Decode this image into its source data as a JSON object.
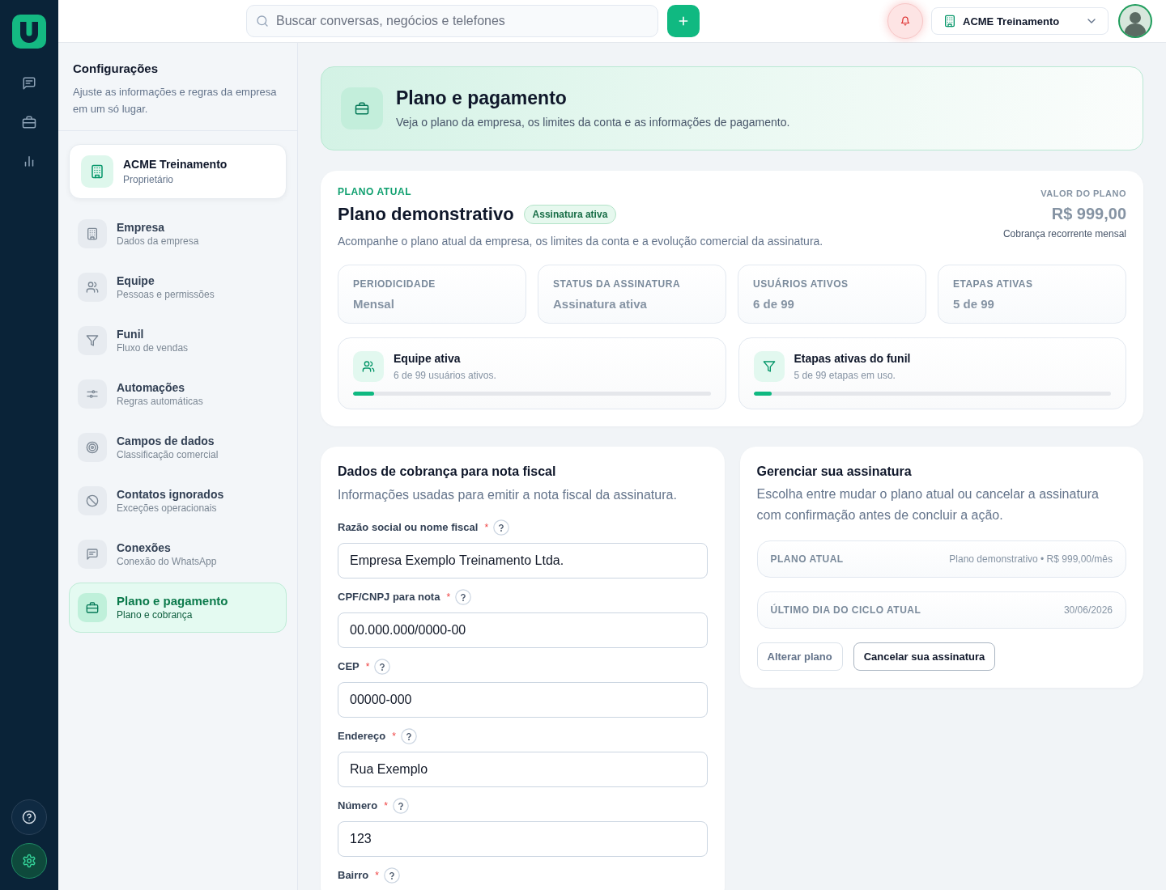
{
  "rail": {
    "top_items": [
      {
        "kind": "chat",
        "selected": false
      },
      {
        "kind": "briefcase",
        "selected": false
      },
      {
        "kind": "chart",
        "selected": false
      }
    ],
    "bottom_items": [
      {
        "kind": "help",
        "selected": false
      },
      {
        "kind": "settings",
        "selected": true
      }
    ]
  },
  "topbar": {
    "search": {
      "placeholder": "Buscar conversas, negócios e telefones"
    },
    "notifications": {
      "alert": true
    },
    "company": {
      "name": "ACME Treinamento"
    }
  },
  "settings_nav": {
    "title": "Configurações",
    "description": "Ajuste as informações e regras da empresa em um só lugar.",
    "account": {
      "name": "ACME Treinamento",
      "role": "Proprietário"
    },
    "items": [
      {
        "kind": "building",
        "title": "Empresa",
        "subtitle": "Dados da empresa",
        "selected": false
      },
      {
        "kind": "users",
        "title": "Equipe",
        "subtitle": "Pessoas e permissões",
        "selected": false
      },
      {
        "kind": "funnel",
        "title": "Funil",
        "subtitle": "Fluxo de vendas",
        "selected": false
      },
      {
        "kind": "sliders",
        "title": "Automações",
        "subtitle": "Regras automáticas",
        "selected": false
      },
      {
        "kind": "target",
        "title": "Campos de dados",
        "subtitle": "Classificação comercial",
        "selected": false
      },
      {
        "kind": "ban",
        "title": "Contatos ignorados",
        "subtitle": "Exceções operacionais",
        "selected": false
      },
      {
        "kind": "chat",
        "title": "Conexões",
        "subtitle": "Conexão do WhatsApp",
        "selected": false
      },
      {
        "kind": "briefcase",
        "title": "Plano e pagamento",
        "subtitle": "Plano e cobrança",
        "selected": true
      }
    ]
  },
  "header": {
    "title": "Plano e pagamento",
    "description": "Veja o plano da empresa, os limites da conta e as informações de pagamento."
  },
  "plan": {
    "eyebrow": "PLANO ATUAL",
    "name": "Plano demonstrativo",
    "badge": "Assinatura ativa",
    "description": "Acompanhe o plano atual da empresa, os limites da conta e a evolução comercial da assinatura.",
    "price_label": "VALOR DO PLANO",
    "price": "R$ 999,00",
    "price_note": "Cobrança recorrente mensal",
    "stats": [
      {
        "label": "PERIODICIDADE",
        "value": "Mensal"
      },
      {
        "label": "STATUS DA ASSINATURA",
        "value": "Assinatura ativa"
      },
      {
        "label": "USUÁRIOS ATIVOS",
        "value": "6 de 99"
      },
      {
        "label": "ETAPAS ATIVAS",
        "value": "5 de 99"
      }
    ],
    "usage": [
      {
        "kind": "users",
        "title": "Equipe ativa",
        "detail": "6 de 99 usuários ativos.",
        "level": 0.06
      },
      {
        "kind": "funnel",
        "title": "Etapas ativas do funil",
        "detail": "5 de 99 etapas em uso.",
        "level": 0.05
      }
    ]
  },
  "billing": {
    "title": "Dados de cobrança para nota fiscal",
    "description": "Informações usadas para emitir a nota fiscal da assinatura.",
    "fields": [
      {
        "label": "Razão social ou nome fiscal",
        "required_mark": "*",
        "value": "Empresa Exemplo Treinamento Ltda."
      },
      {
        "label": "CPF/CNPJ para nota",
        "required_mark": "*",
        "value": "00.000.000/0000-00"
      },
      {
        "label": "CEP",
        "required_mark": "*",
        "value": "00000-000"
      },
      {
        "label": "Endereço",
        "required_mark": "*",
        "value": "Rua Exemplo"
      },
      {
        "label": "Número",
        "required_mark": "*",
        "value": "123"
      },
      {
        "label": "Bairro",
        "required_mark": "*"
      }
    ]
  },
  "manage": {
    "title": "Gerenciar sua assinatura",
    "description": "Escolha entre mudar o plano atual ou cancelar a assinatura com confirmação antes de concluir a ação.",
    "rows": [
      {
        "label": "PLANO ATUAL",
        "value": "Plano demonstrativo • R$ 999,00/mês"
      },
      {
        "label": "ÚLTIMO DIA DO CICLO ATUAL",
        "value": "30/06/2026"
      }
    ],
    "buttons": [
      {
        "kind": "change",
        "label": "Alterar plano"
      },
      {
        "kind": "cancel",
        "label": "Cancelar sua assinatura"
      }
    ]
  }
}
